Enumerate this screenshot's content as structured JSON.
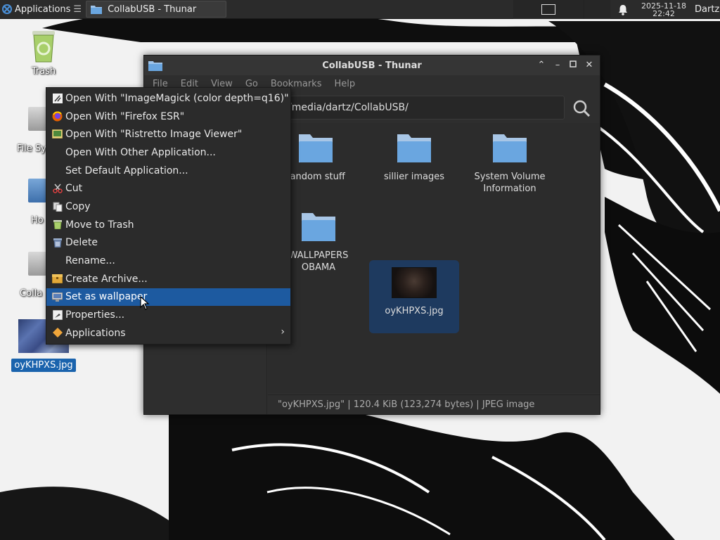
{
  "panel": {
    "applications_label": "Applications",
    "task_title": "CollabUSB - Thunar",
    "clock_date": "2025-11-18",
    "clock_time": "22:42",
    "user": "Dartz"
  },
  "desktop": {
    "trash_label": "Trash",
    "filesystem_fragment": "File Sy",
    "home_fragment": "Ho",
    "collab_fragment": "Colla",
    "image_label": "oyKHPXS.jpg"
  },
  "window": {
    "title": "CollabUSB - Thunar",
    "menu": [
      "File",
      "Edit",
      "View",
      "Go",
      "Bookmarks",
      "Help"
    ],
    "location": "/media/dartz/CollabUSB/",
    "files": [
      {
        "name": "random stuff",
        "kind": "folder"
      },
      {
        "name": "sillier images",
        "kind": "folder"
      },
      {
        "name": "System Volume Information",
        "kind": "folder"
      },
      {
        "name": "WALLPAPERS OBAMA",
        "kind": "folder"
      },
      {
        "name": "oyKHPXS.jpg",
        "kind": "image",
        "selected": true
      }
    ],
    "status": "\"oyKHPXS.jpg\"  |  120.4 KiB (123,274 bytes)  |  JPEG image"
  },
  "context_menu": {
    "items": [
      {
        "label": "Open With \"ImageMagick (color depth=q16)\"",
        "icon": "imagemagick-icon"
      },
      {
        "label": "Open With \"Firefox ESR\"",
        "icon": "firefox-icon"
      },
      {
        "label": "Open With \"Ristretto Image Viewer\"",
        "icon": "image-viewer-icon"
      },
      {
        "label": "Open With Other Application...",
        "icon": ""
      },
      {
        "label": "Set Default Application...",
        "icon": ""
      },
      {
        "label": "Cut",
        "icon": "scissors-icon"
      },
      {
        "label": "Copy",
        "icon": "copy-icon"
      },
      {
        "label": "Move to Trash",
        "icon": "trash-icon"
      },
      {
        "label": "Delete",
        "icon": "delete-icon"
      },
      {
        "label": "Rename...",
        "icon": ""
      },
      {
        "label": "Create Archive...",
        "icon": "archive-icon"
      },
      {
        "label": "Set as wallpaper",
        "icon": "wallpaper-icon",
        "highlighted": true
      },
      {
        "label": "Properties...",
        "icon": "properties-icon"
      },
      {
        "label": "Applications",
        "icon": "applications-icon",
        "submenu": true
      }
    ]
  },
  "colors": {
    "panel_bg": "#2b2b2b",
    "window_bg": "#2e2e2e",
    "highlight": "#1d5aa0",
    "folder_blue": "#6aa6e0"
  }
}
